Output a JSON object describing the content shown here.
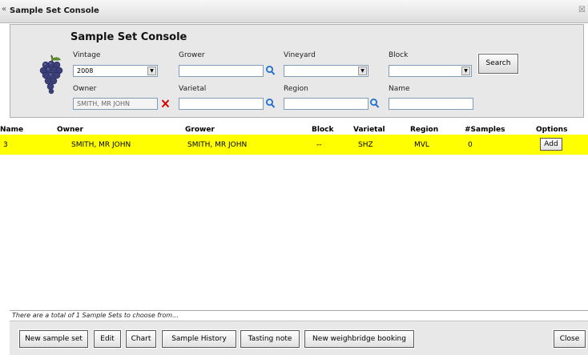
{
  "window": {
    "title": "Sample Set Console",
    "close_glyph": "☒",
    "corner_glyph": "«"
  },
  "panel": {
    "heading": "Sample Set Console",
    "labels": {
      "vintage": "Vintage",
      "grower": "Grower",
      "vineyard": "Vineyard",
      "block": "Block",
      "owner": "Owner",
      "varietal": "Varietal",
      "region": "Region",
      "name": "Name"
    },
    "values": {
      "vintage": "2008",
      "owner": "SMITH, MR JOHN",
      "grower": "",
      "vineyard": "",
      "block": "",
      "varietal": "",
      "region": "",
      "name": ""
    },
    "search_button": "Search"
  },
  "table": {
    "headers": {
      "name": "Name",
      "owner": "Owner",
      "grower": "Grower",
      "block": "Block",
      "varietal": "Varietal",
      "region": "Region",
      "samples": "#Samples",
      "options": "Options"
    },
    "rows": [
      {
        "name": "3",
        "owner": "SMITH, MR JOHN",
        "grower": "SMITH, MR JOHN",
        "block": "--",
        "varietal": "SHZ",
        "region": "MVL",
        "samples": "0",
        "action": "Add"
      }
    ],
    "highlight_color": "#ffff00"
  },
  "status": "There are a total of 1 Sample Sets to choose from...",
  "footer": {
    "new_sample_set": "New sample set",
    "edit": "Edit",
    "chart": "Chart",
    "sample_history": "Sample History",
    "tasting_note": "Tasting note",
    "new_weighbridge_booking": "New weighbridge booking",
    "close": "Close"
  },
  "icons": {
    "search": "magnifier-icon",
    "clear": "red-x-icon",
    "dropdown": "dropdown-arrow-icon",
    "logo": "grape-bunch-icon"
  },
  "colors": {
    "search_icon": "#1f6fd1",
    "clear_icon": "#d40000"
  }
}
